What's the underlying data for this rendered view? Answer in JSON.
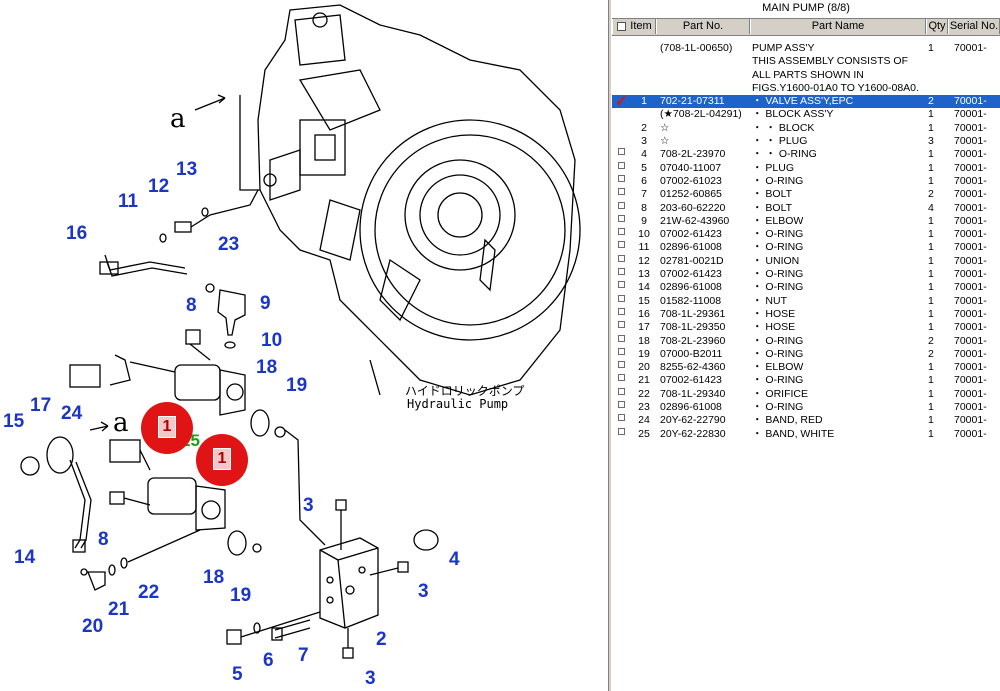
{
  "panel": {
    "title": "MAIN PUMP (8/8)",
    "columns": {
      "item": "Item",
      "part_no": "Part No.",
      "part_name": "Part Name",
      "qty": "Qty",
      "serial": "Serial No."
    },
    "rows": [
      {
        "item": "",
        "part_no": "(708-1L-00650)",
        "name": "PUMP ASS'Y",
        "qty": "1",
        "serial": "70001-",
        "checkbox": false,
        "selected": false
      },
      {
        "item": "",
        "part_no": "",
        "name": "THIS ASSEMBLY CONSISTS OF",
        "qty": "",
        "serial": "",
        "checkbox": false,
        "selected": false
      },
      {
        "item": "",
        "part_no": "",
        "name": "ALL PARTS SHOWN IN",
        "qty": "",
        "serial": "",
        "checkbox": false,
        "selected": false
      },
      {
        "item": "",
        "part_no": "",
        "name": "FIGS.Y1600-01A0 TO Y1600-08A0.",
        "qty": "",
        "serial": "",
        "checkbox": false,
        "selected": false
      },
      {
        "item": "1",
        "part_no": "702-21-07311",
        "name": "・ VALVE ASS'Y,EPC",
        "qty": "2",
        "serial": "70001-",
        "checkbox": true,
        "selected": true,
        "checked": true
      },
      {
        "item": "",
        "part_no": "(★708-2L-04291)",
        "name": "・ BLOCK ASS'Y",
        "qty": "1",
        "serial": "70001-",
        "checkbox": false,
        "selected": false
      },
      {
        "item": "2",
        "part_no": "☆",
        "name": "・ ・ BLOCK",
        "qty": "1",
        "serial": "70001-",
        "checkbox": false,
        "selected": false
      },
      {
        "item": "3",
        "part_no": "☆",
        "name": "・ ・ PLUG",
        "qty": "3",
        "serial": "70001-",
        "checkbox": false,
        "selected": false
      },
      {
        "item": "4",
        "part_no": "708-2L-23970",
        "name": "・ ・ O-RING",
        "qty": "1",
        "serial": "70001-",
        "checkbox": true,
        "selected": false
      },
      {
        "item": "5",
        "part_no": "07040-11007",
        "name": "・ PLUG",
        "qty": "1",
        "serial": "70001-",
        "checkbox": true,
        "selected": false
      },
      {
        "item": "6",
        "part_no": "07002-61023",
        "name": "・ O-RING",
        "qty": "1",
        "serial": "70001-",
        "checkbox": true,
        "selected": false
      },
      {
        "item": "7",
        "part_no": "01252-60865",
        "name": "・ BOLT",
        "qty": "2",
        "serial": "70001-",
        "checkbox": true,
        "selected": false
      },
      {
        "item": "8",
        "part_no": "203-60-62220",
        "name": "・ BOLT",
        "qty": "4",
        "serial": "70001-",
        "checkbox": true,
        "selected": false
      },
      {
        "item": "9",
        "part_no": "21W-62-43960",
        "name": "・ ELBOW",
        "qty": "1",
        "serial": "70001-",
        "checkbox": true,
        "selected": false
      },
      {
        "item": "10",
        "part_no": "07002-61423",
        "name": "・ O-RING",
        "qty": "1",
        "serial": "70001-",
        "checkbox": true,
        "selected": false
      },
      {
        "item": "11",
        "part_no": "02896-61008",
        "name": "・ O-RING",
        "qty": "1",
        "serial": "70001-",
        "checkbox": true,
        "selected": false
      },
      {
        "item": "12",
        "part_no": "02781-0021D",
        "name": "・ UNION",
        "qty": "1",
        "serial": "70001-",
        "checkbox": true,
        "selected": false
      },
      {
        "item": "13",
        "part_no": "07002-61423",
        "name": "・ O-RING",
        "qty": "1",
        "serial": "70001-",
        "checkbox": true,
        "selected": false
      },
      {
        "item": "14",
        "part_no": "02896-61008",
        "name": "・ O-RING",
        "qty": "1",
        "serial": "70001-",
        "checkbox": true,
        "selected": false
      },
      {
        "item": "15",
        "part_no": "01582-11008",
        "name": "・ NUT",
        "qty": "1",
        "serial": "70001-",
        "checkbox": true,
        "selected": false
      },
      {
        "item": "16",
        "part_no": "708-1L-29361",
        "name": "・ HOSE",
        "qty": "1",
        "serial": "70001-",
        "checkbox": true,
        "selected": false
      },
      {
        "item": "17",
        "part_no": "708-1L-29350",
        "name": "・ HOSE",
        "qty": "1",
        "serial": "70001-",
        "checkbox": true,
        "selected": false
      },
      {
        "item": "18",
        "part_no": "708-2L-23960",
        "name": "・ O-RING",
        "qty": "2",
        "serial": "70001-",
        "checkbox": true,
        "selected": false
      },
      {
        "item": "19",
        "part_no": "07000-B2011",
        "name": "・ O-RING",
        "qty": "2",
        "serial": "70001-",
        "checkbox": true,
        "selected": false
      },
      {
        "item": "20",
        "part_no": "8255-62-4360",
        "name": "・ ELBOW",
        "qty": "1",
        "serial": "70001-",
        "checkbox": true,
        "selected": false
      },
      {
        "item": "21",
        "part_no": "07002-61423",
        "name": "・ O-RING",
        "qty": "1",
        "serial": "70001-",
        "checkbox": true,
        "selected": false
      },
      {
        "item": "22",
        "part_no": "708-1L-29340",
        "name": "・ ORIFICE",
        "qty": "1",
        "serial": "70001-",
        "checkbox": true,
        "selected": false
      },
      {
        "item": "23",
        "part_no": "02896-61008",
        "name": "・ O-RING",
        "qty": "1",
        "serial": "70001-",
        "checkbox": true,
        "selected": false
      },
      {
        "item": "24",
        "part_no": "20Y-62-22790",
        "name": "・ BAND, RED",
        "qty": "1",
        "serial": "70001-",
        "checkbox": true,
        "selected": false
      },
      {
        "item": "25",
        "part_no": "20Y-62-22830",
        "name": "・ BAND, WHITE",
        "qty": "1",
        "serial": "70001-",
        "checkbox": true,
        "selected": false
      }
    ]
  },
  "diagram": {
    "caption_jp": "ハイドロリックポンプ",
    "caption_en": "Hydraulic Pump",
    "view_letter": "a",
    "callouts": [
      "1",
      "2",
      "3",
      "4",
      "5",
      "6",
      "7",
      "8",
      "9",
      "10",
      "11",
      "12",
      "13",
      "14",
      "15",
      "16",
      "17",
      "18",
      "19",
      "20",
      "21",
      "22",
      "23",
      "24",
      "25"
    ],
    "marker_labels": [
      "1",
      "1"
    ],
    "colors": {
      "callout": "#1a35c8",
      "marker": "#e01414",
      "selection": "#1d63c9",
      "note_green": "#17a317"
    }
  }
}
